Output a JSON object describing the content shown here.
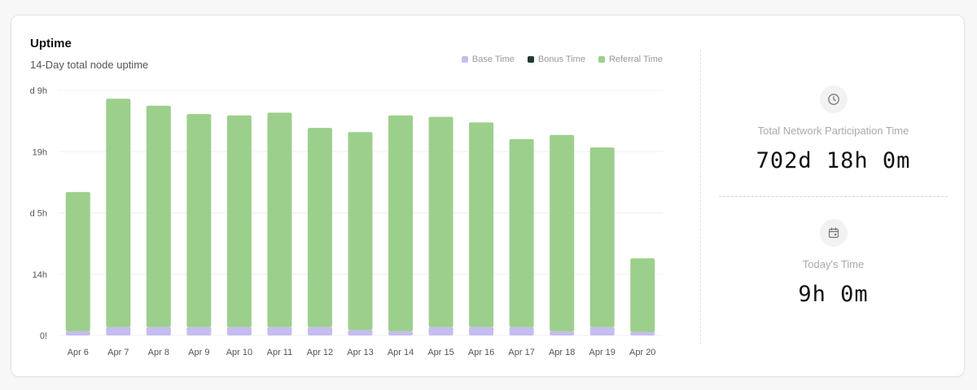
{
  "header": {
    "title": "Uptime",
    "subtitle": "14-Day total node uptime"
  },
  "legend": [
    {
      "label": "Base Time",
      "color": "#c5bdf0"
    },
    {
      "label": "Bonus Time",
      "color": "#1f3b2d"
    },
    {
      "label": "Referral Time",
      "color": "#9ccf8c"
    }
  ],
  "chart_data": {
    "type": "bar",
    "stacked": true,
    "categories": [
      "Apr 6",
      "Apr 7",
      "Apr 8",
      "Apr 9",
      "Apr 10",
      "Apr 11",
      "Apr 12",
      "Apr 13",
      "Apr 14",
      "Apr 15",
      "Apr 16",
      "Apr 17",
      "Apr 18",
      "Apr 19",
      "Apr 20"
    ],
    "y_tick_labels": [
      "0!",
      "14h",
      "d 5h",
      "19h",
      "d 9h"
    ],
    "ylim": [
      0,
      88
    ],
    "grid": true,
    "legend_position": "top-right",
    "series": [
      {
        "name": "Base Time",
        "color": "#c5bdf0",
        "values": [
          1.5,
          3,
          3,
          3,
          3,
          3,
          3,
          2,
          1.5,
          3,
          3,
          3,
          1.5,
          3,
          1.2
        ]
      },
      {
        "name": "Bonus Time",
        "color": "#1f3b2d",
        "values": [
          0,
          0,
          0,
          0,
          0,
          0,
          0,
          0,
          0,
          0,
          0,
          0,
          0,
          0,
          0
        ]
      },
      {
        "name": "Referral Time",
        "color": "#9ccf8c",
        "values": [
          50,
          82,
          79.5,
          76.5,
          76,
          77,
          71.5,
          71,
          77.5,
          75.5,
          73.5,
          67.5,
          70.5,
          64.5,
          26.5
        ]
      }
    ]
  },
  "stats": {
    "total": {
      "label": "Total Network Participation Time",
      "value": "702d 18h 0m",
      "icon": "clock-icon"
    },
    "today": {
      "label": "Today's Time",
      "value": "9h 0m",
      "icon": "calendar-icon"
    }
  }
}
